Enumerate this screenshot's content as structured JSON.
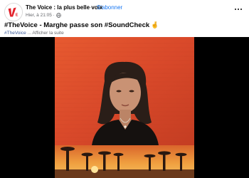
{
  "post": {
    "page_name": "The Voice : la plus belle voix",
    "separator": "·",
    "follow_label": "S'abonner",
    "time": "Hier, à 21:05 ·",
    "title": "#TheVoice - Marghe passe son #SoundCheck",
    "title_emoji": "🤞",
    "hashtag": "#TheVoice",
    "see_more": "... Afficher la suite"
  },
  "icons": {
    "avatar": "the-voice-logo",
    "privacy": "globe-icon",
    "menu": "more-options-icon"
  },
  "colors": {
    "link": "#1877f2",
    "secondary_text": "#65676b",
    "brand_red": "#e3212a",
    "video_bg": "#e2542c"
  }
}
